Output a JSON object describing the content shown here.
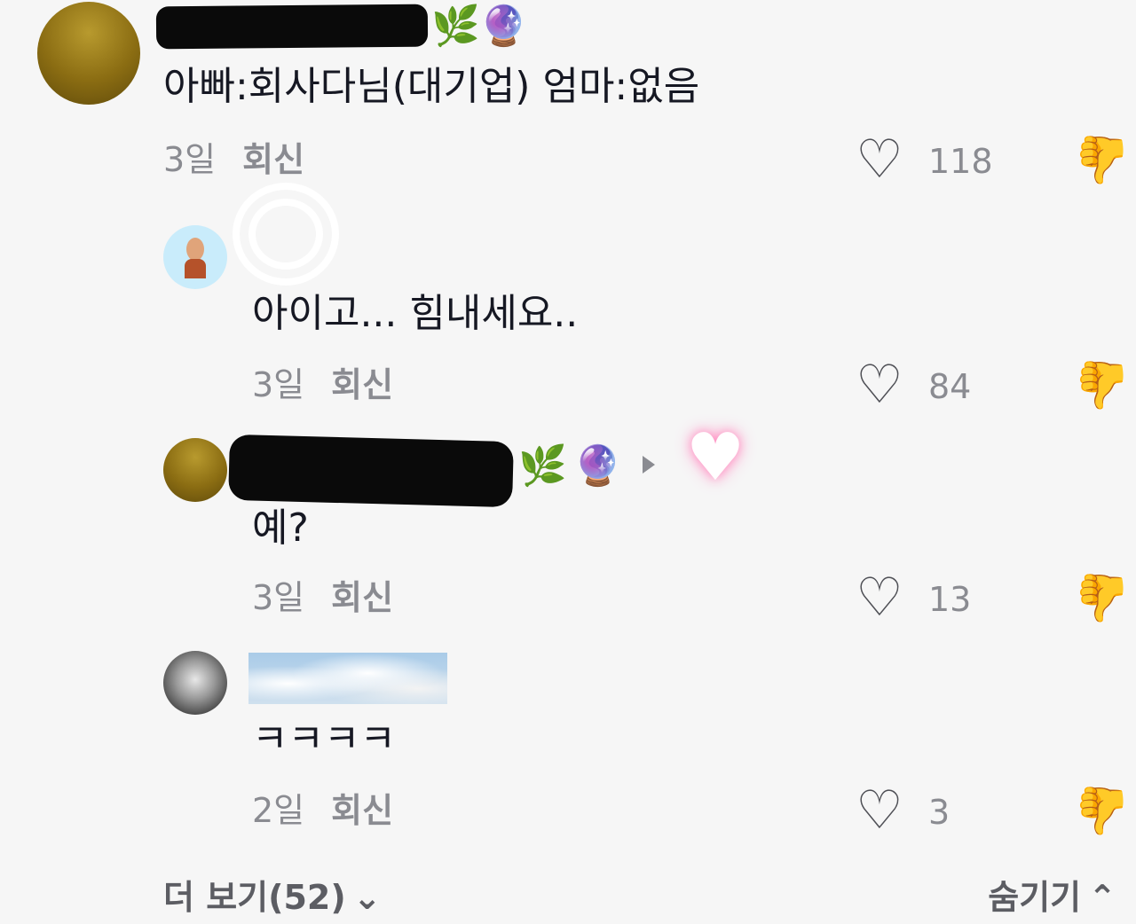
{
  "comments": [
    {
      "text": "아빠:회사다님(대기업) 엄마:없음",
      "time": "3일",
      "reply_label": "회신",
      "likes": "118",
      "badges": [
        "🌿",
        "🔮"
      ]
    },
    {
      "text": "아이고... 힘내세요..",
      "time": "3일",
      "reply_label": "회신",
      "likes": "84"
    },
    {
      "text": "예?",
      "time": "3일",
      "reply_label": "회신",
      "likes": "13",
      "badges": [
        "🌿",
        "🔮"
      ]
    },
    {
      "text": "ㅋㅋㅋㅋ",
      "time": "2일",
      "reply_label": "회신",
      "likes": "3"
    }
  ],
  "icons": {
    "heart": "♡",
    "dislike": "👍",
    "reply_arrow": "play-triangle",
    "sticker_heart": "♥"
  },
  "footer": {
    "more_label": "더 보기(52)",
    "more_chevron": "⌄",
    "hide_label": "숨기기",
    "hide_chevron": "⌃"
  }
}
